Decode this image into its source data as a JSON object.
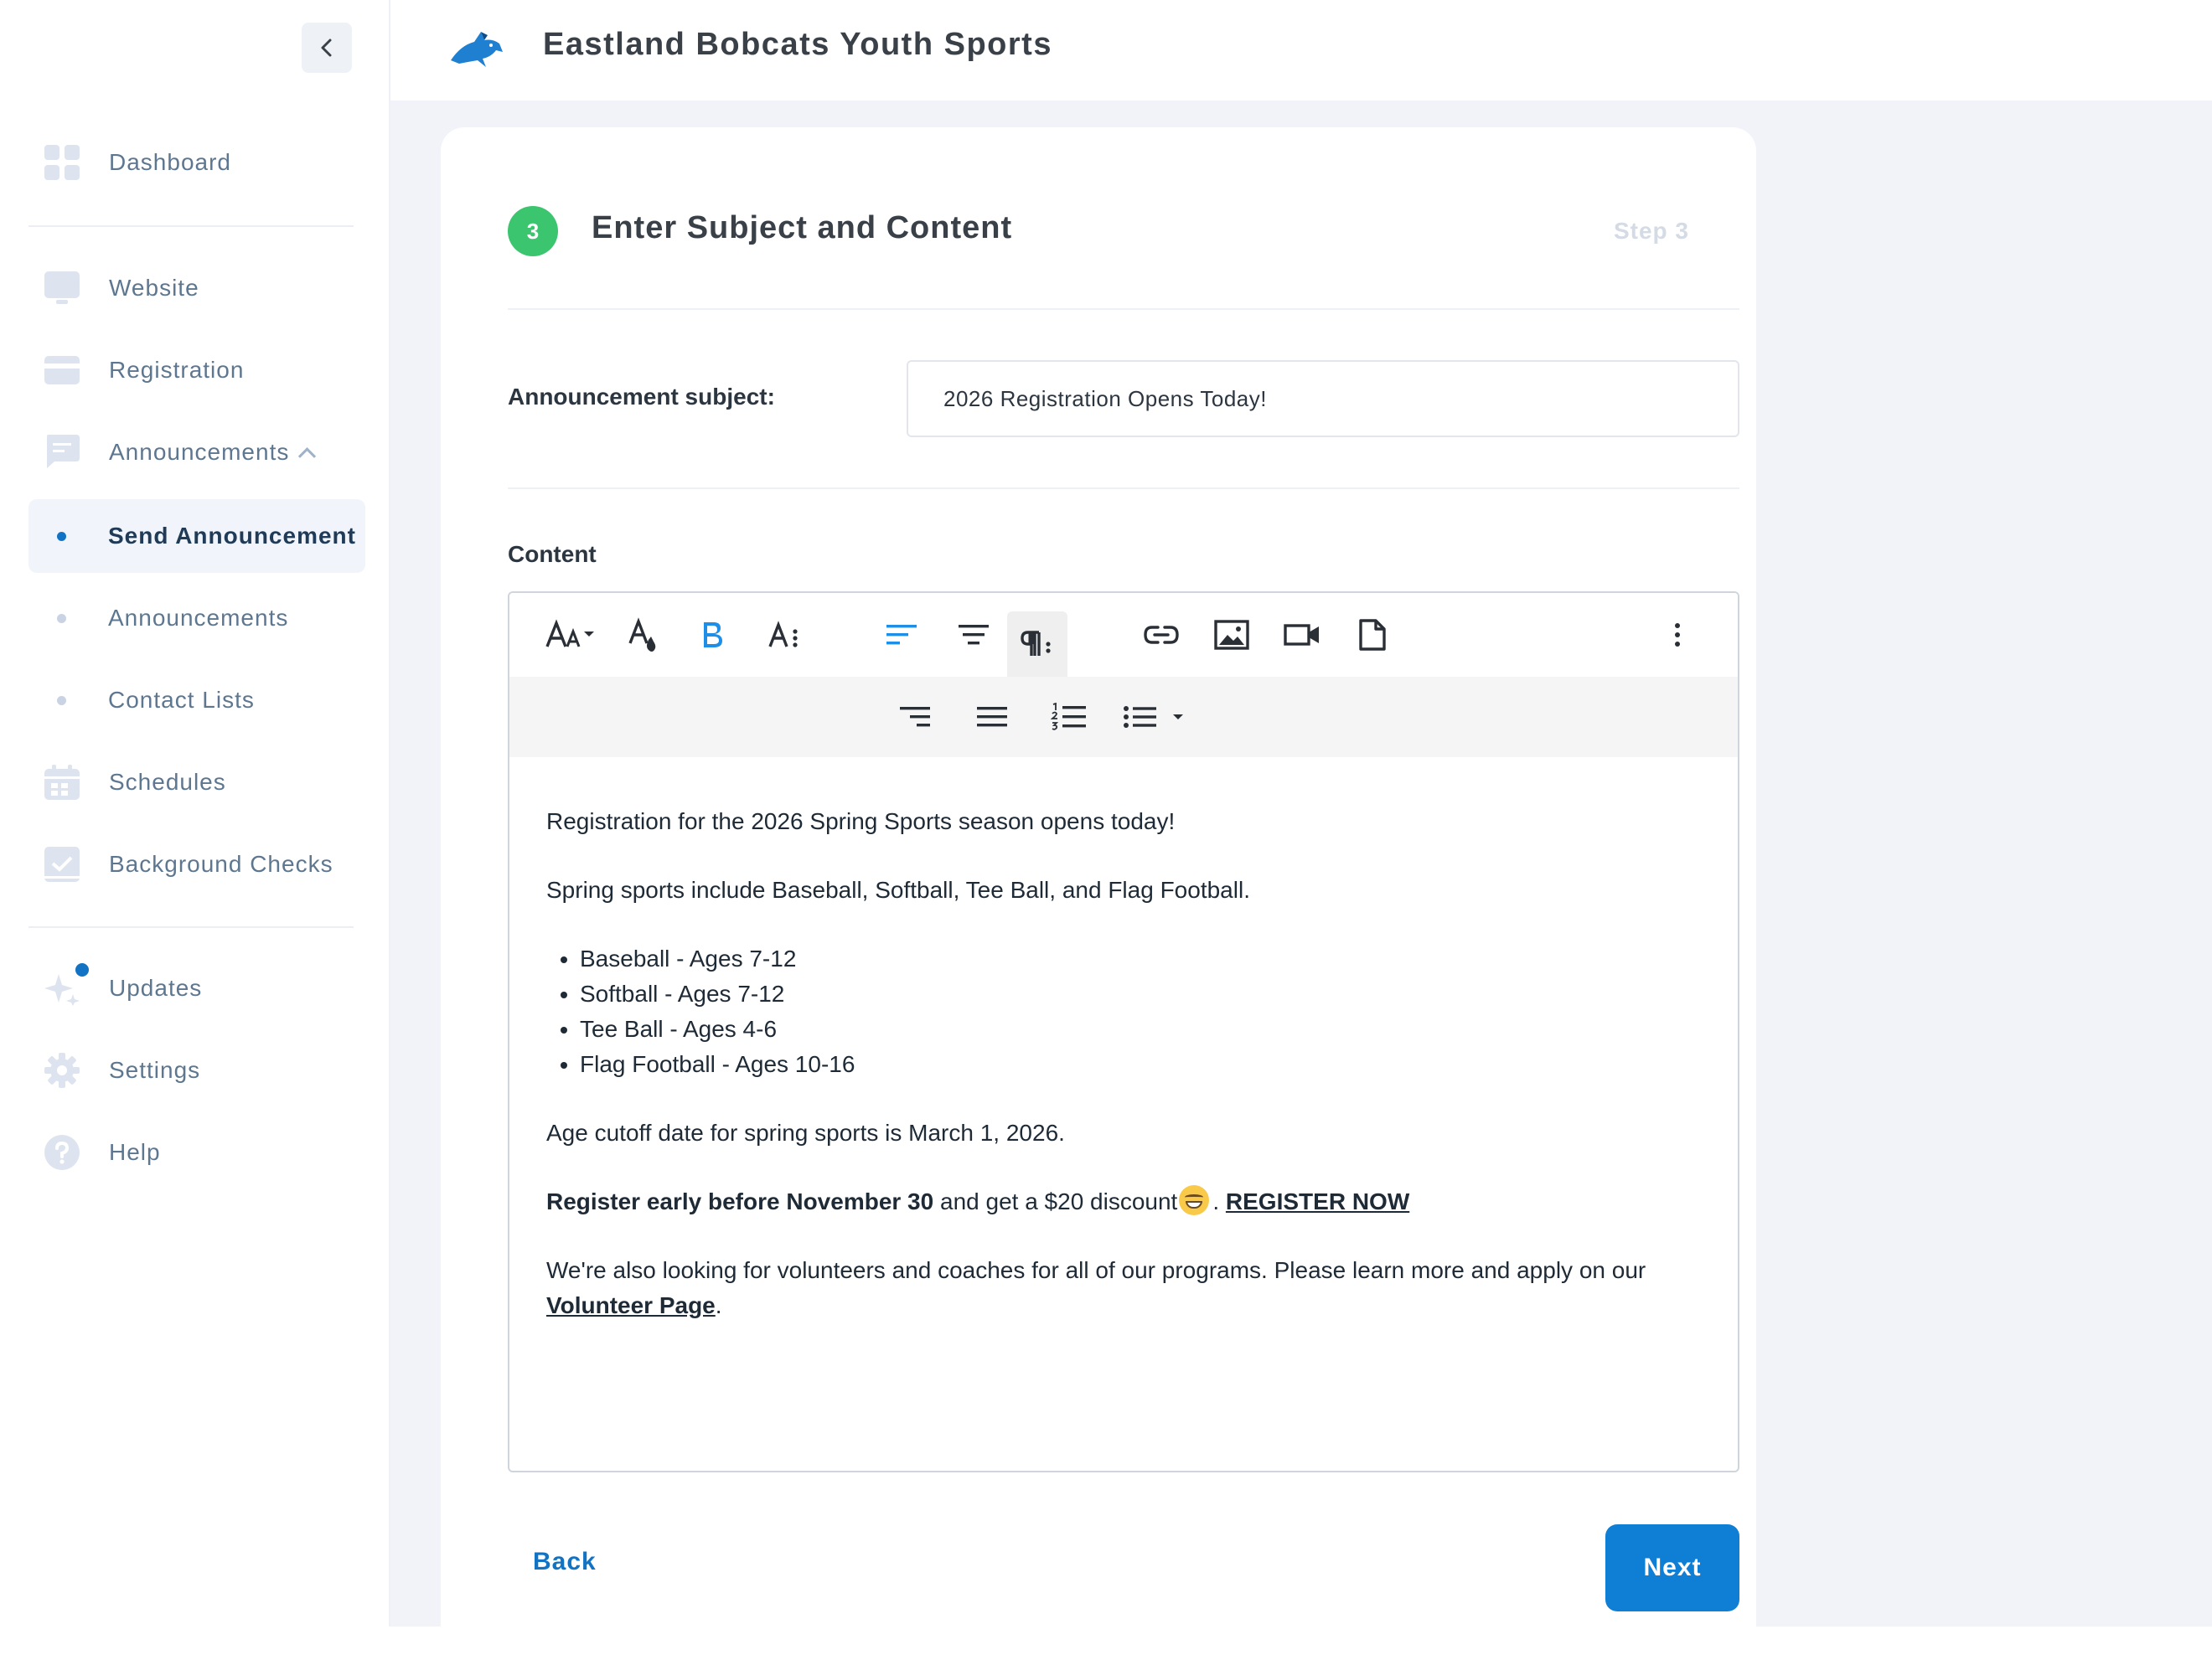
{
  "app": {
    "org_name": "Eastland Bobcats Youth Sports",
    "logo_icon": "bobcat-logo-icon",
    "accent": "#1273c4"
  },
  "sidebar": {
    "items": [
      {
        "label": "Dashboard",
        "icon": "dashboard-icon"
      },
      {
        "label": "Website",
        "icon": "monitor-icon"
      },
      {
        "label": "Registration",
        "icon": "card-icon"
      },
      {
        "label": "Announcements",
        "icon": "message-icon",
        "expanded": true
      },
      {
        "label": "Send Announcement",
        "sub": true,
        "active": true
      },
      {
        "label": "Announcements",
        "sub": true
      },
      {
        "label": "Contact Lists",
        "sub": true
      },
      {
        "label": "Schedules",
        "icon": "calendar-icon"
      },
      {
        "label": "Background Checks",
        "icon": "check-window-icon"
      },
      {
        "label": "Updates",
        "icon": "sparkle-icon",
        "has_notification": true
      },
      {
        "label": "Settings",
        "icon": "gear-icon"
      },
      {
        "label": "Help",
        "icon": "help-icon"
      }
    ]
  },
  "wizard": {
    "step_number": "3",
    "title": "Enter Subject and Content",
    "step_label": "Step 3",
    "subject_label": "Announcement subject:",
    "subject_value": "2026 Registration Opens Today!",
    "content_label": "Content",
    "back_label": "Back",
    "next_label": "Next"
  },
  "editor": {
    "toolbar_row1": [
      "font-size-icon",
      "text-color-icon",
      "bold-icon",
      "text-style-icon",
      "align-left-icon",
      "align-center-icon",
      "paragraph-format-icon",
      "insert-link-icon",
      "insert-image-icon",
      "insert-video-icon",
      "insert-file-icon",
      "more-icon"
    ],
    "toolbar_row2": [
      "align-right-icon",
      "align-justify-icon",
      "ordered-list-icon",
      "unordered-list-icon"
    ],
    "content": {
      "p1": "Registration for the 2026 Spring Sports season opens today!",
      "p2": "Spring sports include Baseball, Softball, Tee Ball, and Flag Football.",
      "list": [
        "Baseball - Ages 7-12",
        "Softball - Ages 7-12",
        "Tee Ball - Ages 4-6",
        "Flag Football - Ages 10-16"
      ],
      "p3": "Age cutoff date for spring sports is March 1, 2026.",
      "p4_bold": "Register early before November 30",
      "p4_text": " and get a $20 discount",
      "p4_sep": ". ",
      "p4_link": "REGISTER NOW",
      "p5_text": "We're also looking for volunteers and coaches for all of our programs. Please learn more and apply on our ",
      "p5_link": "Volunteer Page",
      "p5_end": "."
    }
  }
}
